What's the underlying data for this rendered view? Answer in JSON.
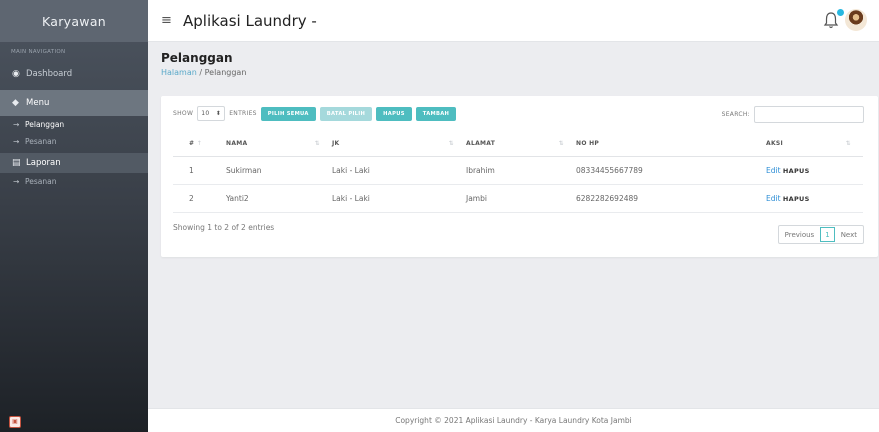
{
  "sidebar": {
    "brand": "Karyawan",
    "nav_header": "MAIN NAVIGATION",
    "dashboard": "Dashboard",
    "menu": "Menu",
    "menu_items": [
      "Pelanggan",
      "Pesanan"
    ],
    "laporan": "Laporan",
    "laporan_items": [
      "Pesanan"
    ]
  },
  "topbar": {
    "title": "Aplikasi Laundry -",
    "hamburger": "≡"
  },
  "content": {
    "page_title": "Pelanggan",
    "breadcrumb_home": "Halaman",
    "breadcrumb_sep": "/",
    "breadcrumb_current": "Pelanggan"
  },
  "table_controls": {
    "show": "SHOW",
    "entries_value": "10",
    "entries": "ENTRIES",
    "btn_pilih_semua": "PILIH SEMUA",
    "btn_batal_pilih": "BATAL PILIH",
    "btn_hapus": "HAPUS",
    "btn_tambah": "TAMBAH",
    "search_label": "SEARCH:",
    "search_value": ""
  },
  "table": {
    "headers": [
      "#",
      "NAMA",
      "JK",
      "ALAMAT",
      "NO HP",
      "AKSI"
    ],
    "rows": [
      {
        "no": "1",
        "nama": "Sukirman",
        "jk": "Laki - Laki",
        "alamat": "Ibrahim",
        "nohp": "08334455667789",
        "edit": "Edit",
        "hapus": "HAPUS"
      },
      {
        "no": "2",
        "nama": "Yanti2",
        "jk": "Laki - Laki",
        "alamat": "Jambi",
        "nohp": "6282282692489",
        "edit": "Edit",
        "hapus": "HAPUS"
      }
    ]
  },
  "pagination": {
    "info": "Showing 1 to 2 of 2 entries",
    "previous": "Previous",
    "current": "1",
    "next": "Next"
  },
  "footer": {
    "text": "Copyright © 2021 Aplikasi Laundry - Karya Laundry Kota Jambi"
  },
  "colors": {
    "accent": "#4ebdc0",
    "link": "#2f8fd6",
    "notification": "#28b8e0"
  }
}
